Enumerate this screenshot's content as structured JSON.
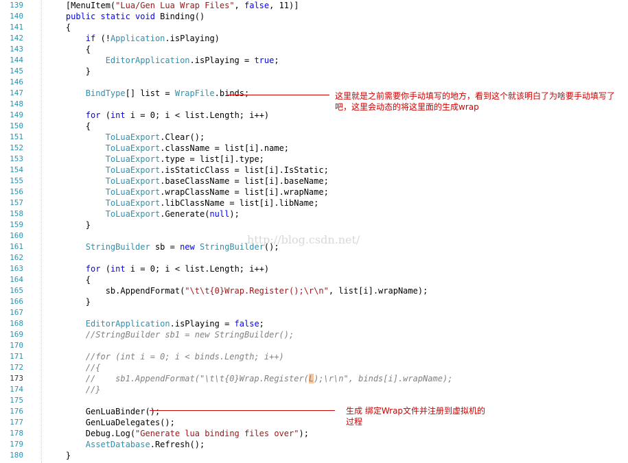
{
  "editor": {
    "lines": [
      {
        "n": "139",
        "tokens": [
          [
            "",
            "    "
          ],
          [
            "",
            "[MenuItem("
          ],
          [
            "st",
            "\"Lua/Gen Lua Wrap Files\""
          ],
          [
            "",
            ", "
          ],
          [
            "kw",
            "false"
          ],
          [
            "",
            ", 11)]"
          ]
        ]
      },
      {
        "n": "140",
        "tokens": [
          [
            "",
            "    "
          ],
          [
            "kw",
            "public static void"
          ],
          [
            "",
            " Binding()"
          ]
        ]
      },
      {
        "n": "141",
        "tokens": [
          [
            "",
            "    {"
          ]
        ]
      },
      {
        "n": "142",
        "tokens": [
          [
            "",
            "        "
          ],
          [
            "kw",
            "if"
          ],
          [
            "",
            " (!"
          ],
          [
            "ty",
            "Application"
          ],
          [
            "",
            ".isPlaying)"
          ]
        ]
      },
      {
        "n": "143",
        "tokens": [
          [
            "",
            "        {"
          ]
        ]
      },
      {
        "n": "144",
        "tokens": [
          [
            "",
            "            "
          ],
          [
            "ty",
            "EditorApplication"
          ],
          [
            "",
            ".isPlaying = "
          ],
          [
            "kw",
            "true"
          ],
          [
            "",
            ";"
          ]
        ]
      },
      {
        "n": "145",
        "tokens": [
          [
            "",
            "        }"
          ]
        ]
      },
      {
        "n": "146",
        "tokens": []
      },
      {
        "n": "147",
        "tokens": [
          [
            "",
            "        "
          ],
          [
            "ty",
            "BindType"
          ],
          [
            "",
            "[] list = "
          ],
          [
            "ty",
            "WrapFile"
          ],
          [
            "",
            ".binds;"
          ]
        ]
      },
      {
        "n": "148",
        "tokens": []
      },
      {
        "n": "149",
        "tokens": [
          [
            "",
            "        "
          ],
          [
            "kw",
            "for"
          ],
          [
            "",
            " ("
          ],
          [
            "kw",
            "int"
          ],
          [
            "",
            " i = 0; i < list.Length; i++)"
          ]
        ]
      },
      {
        "n": "150",
        "tokens": [
          [
            "",
            "        {"
          ]
        ]
      },
      {
        "n": "151",
        "tokens": [
          [
            "",
            "            "
          ],
          [
            "ty",
            "ToLuaExport"
          ],
          [
            "",
            ".Clear();"
          ]
        ]
      },
      {
        "n": "152",
        "tokens": [
          [
            "",
            "            "
          ],
          [
            "ty",
            "ToLuaExport"
          ],
          [
            "",
            ".className = list[i].name;"
          ]
        ]
      },
      {
        "n": "153",
        "tokens": [
          [
            "",
            "            "
          ],
          [
            "ty",
            "ToLuaExport"
          ],
          [
            "",
            ".type = list[i].type;"
          ]
        ]
      },
      {
        "n": "154",
        "tokens": [
          [
            "",
            "            "
          ],
          [
            "ty",
            "ToLuaExport"
          ],
          [
            "",
            ".isStaticClass = list[i].IsStatic;"
          ]
        ]
      },
      {
        "n": "155",
        "tokens": [
          [
            "",
            "            "
          ],
          [
            "ty",
            "ToLuaExport"
          ],
          [
            "",
            ".baseClassName = list[i].baseName;"
          ]
        ]
      },
      {
        "n": "156",
        "tokens": [
          [
            "",
            "            "
          ],
          [
            "ty",
            "ToLuaExport"
          ],
          [
            "",
            ".wrapClassName = list[i].wrapName;"
          ]
        ]
      },
      {
        "n": "157",
        "tokens": [
          [
            "",
            "            "
          ],
          [
            "ty",
            "ToLuaExport"
          ],
          [
            "",
            ".libClassName = list[i].libName;"
          ]
        ]
      },
      {
        "n": "158",
        "tokens": [
          [
            "",
            "            "
          ],
          [
            "ty",
            "ToLuaExport"
          ],
          [
            "",
            ".Generate("
          ],
          [
            "kw",
            "null"
          ],
          [
            "",
            ");"
          ]
        ]
      },
      {
        "n": "159",
        "tokens": [
          [
            "",
            "        }"
          ]
        ]
      },
      {
        "n": "160",
        "tokens": []
      },
      {
        "n": "161",
        "tokens": [
          [
            "",
            "        "
          ],
          [
            "ty",
            "StringBuilder"
          ],
          [
            "",
            " sb = "
          ],
          [
            "kw",
            "new"
          ],
          [
            "",
            " "
          ],
          [
            "ty",
            "StringBuilder"
          ],
          [
            "",
            "();"
          ]
        ]
      },
      {
        "n": "162",
        "tokens": []
      },
      {
        "n": "163",
        "tokens": [
          [
            "",
            "        "
          ],
          [
            "kw",
            "for"
          ],
          [
            "",
            " ("
          ],
          [
            "kw",
            "int"
          ],
          [
            "",
            " i = 0; i < list.Length; i++)"
          ]
        ]
      },
      {
        "n": "164",
        "tokens": [
          [
            "",
            "        {"
          ]
        ]
      },
      {
        "n": "165",
        "tokens": [
          [
            "",
            "            sb.AppendFormat("
          ],
          [
            "st",
            "\"\\t\\t{0}Wrap.Register();\\r\\n\""
          ],
          [
            "",
            ", list[i].wrapName);"
          ]
        ]
      },
      {
        "n": "166",
        "tokens": [
          [
            "",
            "        }"
          ]
        ]
      },
      {
        "n": "167",
        "tokens": []
      },
      {
        "n": "168",
        "tokens": [
          [
            "",
            "        "
          ],
          [
            "ty",
            "EditorApplication"
          ],
          [
            "",
            ".isPlaying = "
          ],
          [
            "kw",
            "false"
          ],
          [
            "",
            ";"
          ]
        ]
      },
      {
        "n": "169",
        "tokens": [
          [
            "",
            "        "
          ],
          [
            "cm",
            "//StringBuilder sb1 = new StringBuilder();"
          ]
        ]
      },
      {
        "n": "170",
        "tokens": []
      },
      {
        "n": "171",
        "tokens": [
          [
            "",
            "        "
          ],
          [
            "cm",
            "//for (int i = 0; i < binds.Length; i++)"
          ]
        ]
      },
      {
        "n": "172",
        "tokens": [
          [
            "",
            "        "
          ],
          [
            "cm",
            "//{"
          ]
        ]
      },
      {
        "n": "173",
        "active": true,
        "tokens": [
          [
            "",
            "        "
          ],
          [
            "cm",
            "//    sb1.AppendFormat(\"\\t\\t{0}Wrap.Register("
          ],
          [
            "cm hl",
            "L"
          ],
          [
            "cm",
            ");\\r\\n\", binds[i].wrapName);"
          ]
        ]
      },
      {
        "n": "174",
        "tokens": [
          [
            "",
            "        "
          ],
          [
            "cm",
            "//}"
          ]
        ]
      },
      {
        "n": "175",
        "tokens": []
      },
      {
        "n": "176",
        "tokens": [
          [
            "",
            "        GenLuaBinder();"
          ]
        ]
      },
      {
        "n": "177",
        "tokens": [
          [
            "",
            "        GenLuaDelegates();"
          ]
        ]
      },
      {
        "n": "178",
        "tokens": [
          [
            "",
            "        Debug.Log("
          ],
          [
            "st",
            "\"Generate lua binding files over\""
          ],
          [
            "",
            ");"
          ]
        ]
      },
      {
        "n": "179",
        "tokens": [
          [
            "",
            "        "
          ],
          [
            "ty",
            "AssetDatabase"
          ],
          [
            "",
            ".Refresh();"
          ]
        ]
      },
      {
        "n": "180",
        "tokens": [
          [
            "",
            "    }"
          ]
        ]
      }
    ]
  },
  "annotations": {
    "note1": "这里就是之前需要你手动填写的地方，看到这个就该明白了为啥要手动填写了吧，这里会动态的将这里面的生成wrap",
    "note2": "生成 绑定Wrap文件并注册到虚拟机的过程"
  },
  "watermark": "http://blog.csdn.net/",
  "colors": {
    "keyword": "#0000ff",
    "type": "#2b91af",
    "string": "#a31515",
    "comment": "#808080",
    "annotation": "#cc0000"
  }
}
